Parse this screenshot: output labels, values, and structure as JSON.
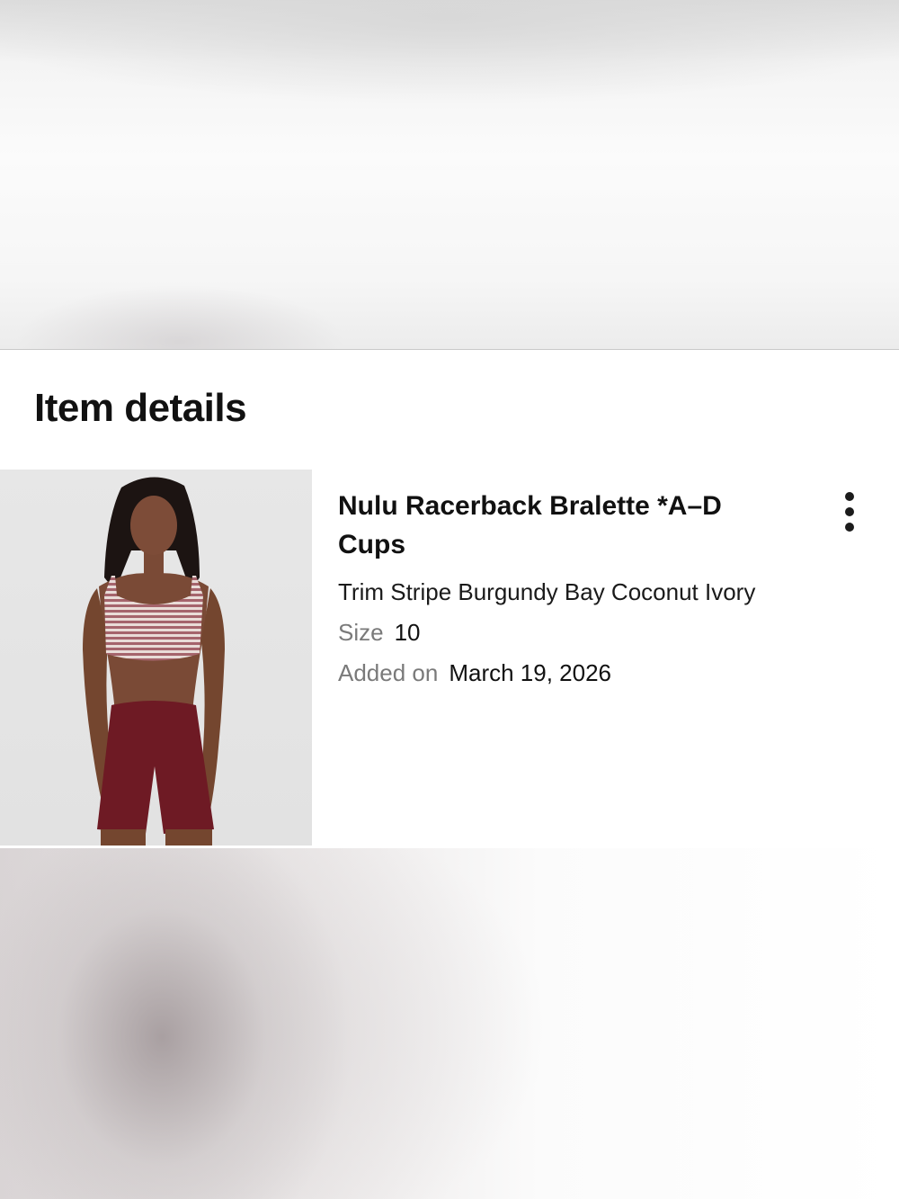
{
  "section": {
    "title": "Item details"
  },
  "item": {
    "name": "Nulu Racerback Bralette *A–D Cups",
    "variant": "Trim Stripe Burgundy Bay Coconut Ivory",
    "size_label": "Size",
    "size_value": "10",
    "added_label": "Added on",
    "added_value": "March 19, 2026",
    "image_icon": "product-photo",
    "more_icon": "vertical-ellipsis-icon"
  },
  "colors": {
    "bralette_stripe": "#b98a8e",
    "shorts": "#6e1a24",
    "skin": "#7a4a36",
    "hair": "#1c1412"
  }
}
